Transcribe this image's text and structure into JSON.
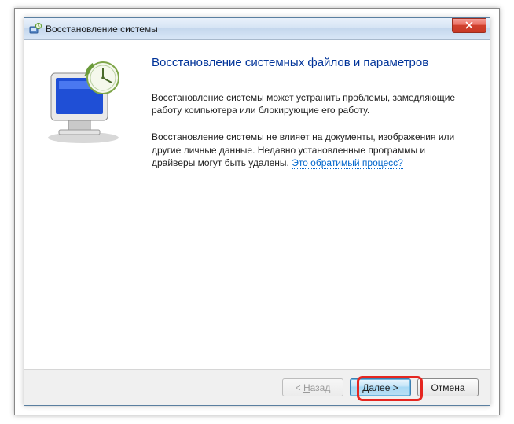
{
  "titlebar": {
    "title": "Восстановление системы"
  },
  "content": {
    "heading": "Восстановление системных файлов и параметров",
    "para1": "Восстановление системы может устранить проблемы, замедляющие работу компьютера или блокирующие его работу.",
    "para2_part1": "Восстановление системы не влияет на документы, изображения или другие личные данные. Недавно установленные программы и драйверы могут быть удалены. ",
    "para2_link": "Это обратимый процесс?"
  },
  "buttons": {
    "back_prefix": "< ",
    "back_underline": "Н",
    "back_rest": "азад",
    "next_underline": "Д",
    "next_rest": "алее >",
    "cancel": "Отмена"
  }
}
